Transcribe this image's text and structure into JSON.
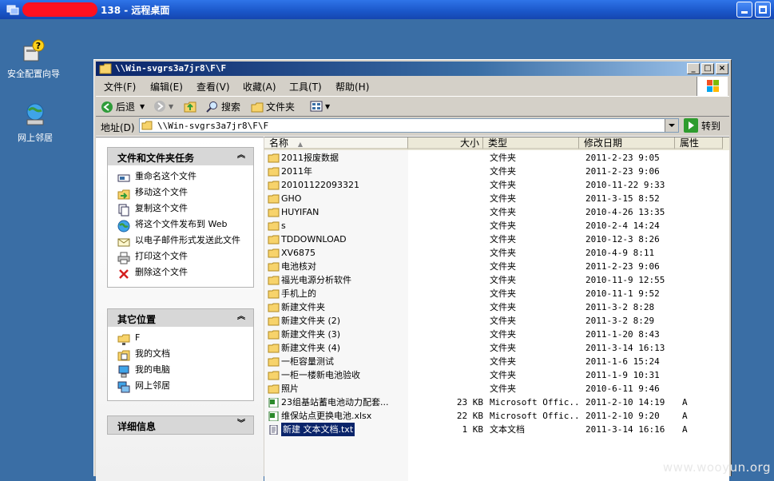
{
  "remote_desktop": {
    "title": "138 - 远程桌面"
  },
  "desktop_icons": [
    {
      "label": "安全配置向导",
      "icon": "security-wizard-icon"
    },
    {
      "label": "网上邻居",
      "icon": "network-places-icon"
    }
  ],
  "explorer": {
    "title": "\\\\Win-svgrs3a7jr8\\F\\F",
    "menu": [
      "文件(F)",
      "编辑(E)",
      "查看(V)",
      "收藏(A)",
      "工具(T)",
      "帮助(H)"
    ],
    "toolbar": {
      "back": "后退",
      "search": "搜索",
      "folders": "文件夹"
    },
    "address": {
      "label": "地址(D)",
      "value": "\\\\Win-svgrs3a7jr8\\F\\F",
      "go": "转到"
    },
    "tasks_panel": {
      "title": "文件和文件夹任务",
      "items": [
        "重命名这个文件",
        "移动这个文件",
        "复制这个文件",
        "将这个文件发布到 Web",
        "以电子邮件形式发送此文件",
        "打印这个文件",
        "删除这个文件"
      ]
    },
    "places_panel": {
      "title": "其它位置",
      "items": [
        "F",
        "我的文档",
        "我的电脑",
        "网上邻居"
      ]
    },
    "details_panel": {
      "title": "详细信息"
    },
    "columns": {
      "name": "名称",
      "size": "大小",
      "type": "类型",
      "date": "修改日期",
      "attr": "属性"
    },
    "files": [
      {
        "name": "2011报废数据",
        "size": "",
        "type": "文件夹",
        "date": "2011-2-23 9:05",
        "attr": "",
        "kind": "folder"
      },
      {
        "name": "2011年",
        "size": "",
        "type": "文件夹",
        "date": "2011-2-23 9:06",
        "attr": "",
        "kind": "folder"
      },
      {
        "name": "20101122093321",
        "size": "",
        "type": "文件夹",
        "date": "2010-11-22 9:33",
        "attr": "",
        "kind": "folder"
      },
      {
        "name": "GHO",
        "size": "",
        "type": "文件夹",
        "date": "2011-3-15 8:52",
        "attr": "",
        "kind": "folder"
      },
      {
        "name": "HUYIFAN",
        "size": "",
        "type": "文件夹",
        "date": "2010-4-26 13:35",
        "attr": "",
        "kind": "folder"
      },
      {
        "name": "s",
        "size": "",
        "type": "文件夹",
        "date": "2010-2-4 14:24",
        "attr": "",
        "kind": "folder"
      },
      {
        "name": "TDDOWNLOAD",
        "size": "",
        "type": "文件夹",
        "date": "2010-12-3 8:26",
        "attr": "",
        "kind": "folder"
      },
      {
        "name": "XV6875",
        "size": "",
        "type": "文件夹",
        "date": "2010-4-9 8:11",
        "attr": "",
        "kind": "folder"
      },
      {
        "name": "电池核对",
        "size": "",
        "type": "文件夹",
        "date": "2011-2-23 9:06",
        "attr": "",
        "kind": "folder"
      },
      {
        "name": "福光电源分析软件",
        "size": "",
        "type": "文件夹",
        "date": "2010-11-9 12:55",
        "attr": "",
        "kind": "folder"
      },
      {
        "name": "手机上的",
        "size": "",
        "type": "文件夹",
        "date": "2010-11-1 9:52",
        "attr": "",
        "kind": "folder"
      },
      {
        "name": "新建文件夹",
        "size": "",
        "type": "文件夹",
        "date": "2011-3-2 8:28",
        "attr": "",
        "kind": "folder"
      },
      {
        "name": "新建文件夹 (2)",
        "size": "",
        "type": "文件夹",
        "date": "2011-3-2 8:29",
        "attr": "",
        "kind": "folder"
      },
      {
        "name": "新建文件夹 (3)",
        "size": "",
        "type": "文件夹",
        "date": "2011-1-20 8:43",
        "attr": "",
        "kind": "folder"
      },
      {
        "name": "新建文件夹 (4)",
        "size": "",
        "type": "文件夹",
        "date": "2011-3-14 16:13",
        "attr": "",
        "kind": "folder"
      },
      {
        "name": "一柜容量测试",
        "size": "",
        "type": "文件夹",
        "date": "2011-1-6 15:24",
        "attr": "",
        "kind": "folder"
      },
      {
        "name": "一柜一楼新电池验收",
        "size": "",
        "type": "文件夹",
        "date": "2011-1-9 10:31",
        "attr": "",
        "kind": "folder"
      },
      {
        "name": "照片",
        "size": "",
        "type": "文件夹",
        "date": "2010-6-11 9:46",
        "attr": "",
        "kind": "folder"
      },
      {
        "name": "23组基站蓄电池动力配套...",
        "size": "23 KB",
        "type": "Microsoft Offic...",
        "date": "2011-2-10 14:19",
        "attr": "A",
        "kind": "excel"
      },
      {
        "name": "维保站点更换电池.xlsx",
        "size": "22 KB",
        "type": "Microsoft Offic...",
        "date": "2011-2-10 9:20",
        "attr": "A",
        "kind": "excel"
      },
      {
        "name": "新建 文本文档.txt",
        "size": "1 KB",
        "type": "文本文档",
        "date": "2011-3-14 16:16",
        "attr": "A",
        "kind": "txt",
        "selected": true
      }
    ]
  },
  "watermark": "www.wooyun.org",
  "colors": {
    "desktop": "#3A6EA5",
    "titlebar": "#1a56c8",
    "selection": "#0a246a"
  }
}
